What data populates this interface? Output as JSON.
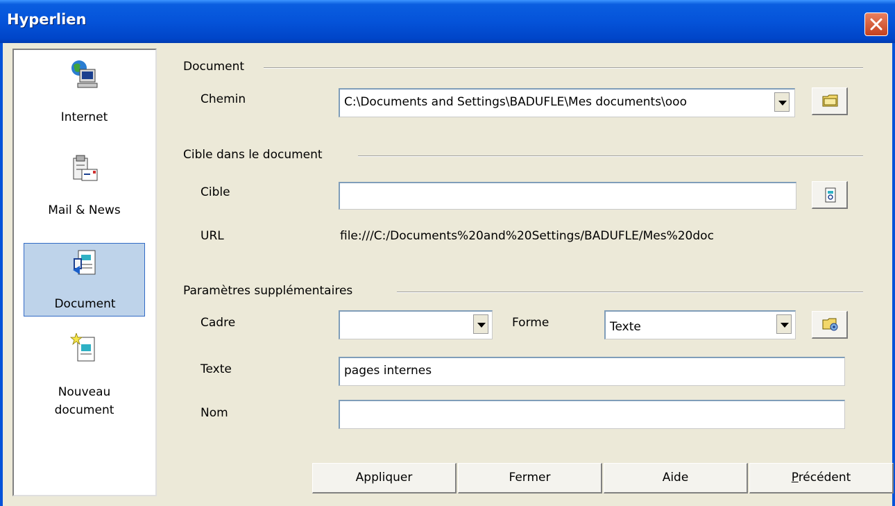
{
  "window": {
    "title": "Hyperlien"
  },
  "sidebar": {
    "items": [
      {
        "label": "Internet",
        "icon": "internet-globe-icon"
      },
      {
        "label": "Mail & News",
        "icon": "mail-news-icon"
      },
      {
        "label": "Document",
        "icon": "document-icon",
        "selected": true
      },
      {
        "label_line1": "Nouveau",
        "label_line2": "document",
        "icon": "new-document-icon"
      }
    ]
  },
  "document_group": {
    "heading": "Document",
    "path_label": "Chemin",
    "path_value": "C:\\Documents and Settings\\BADUFLE\\Mes documents\\ooo"
  },
  "target_group": {
    "heading": "Cible dans le document",
    "target_label": "Cible",
    "target_value": "",
    "url_label": "URL",
    "url_value": "file:///C:/Documents%20and%20Settings/BADUFLE/Mes%20doc"
  },
  "extra_group": {
    "heading": "Paramètres supplémentaires",
    "frame_label": "Cadre",
    "frame_value": "",
    "form_label": "Forme",
    "form_value": "Texte",
    "text_label": "Texte",
    "text_value": "pages internes",
    "name_label": "Nom",
    "name_value": ""
  },
  "buttons": {
    "apply": "Appliquer",
    "close": "Fermer",
    "help": "Aide",
    "previous_first": "P",
    "previous_rest": "récédent"
  },
  "colors": {
    "titlebar": "#0553d9",
    "dialog_bg": "#ece9d8",
    "selection": "#bed3ea"
  }
}
